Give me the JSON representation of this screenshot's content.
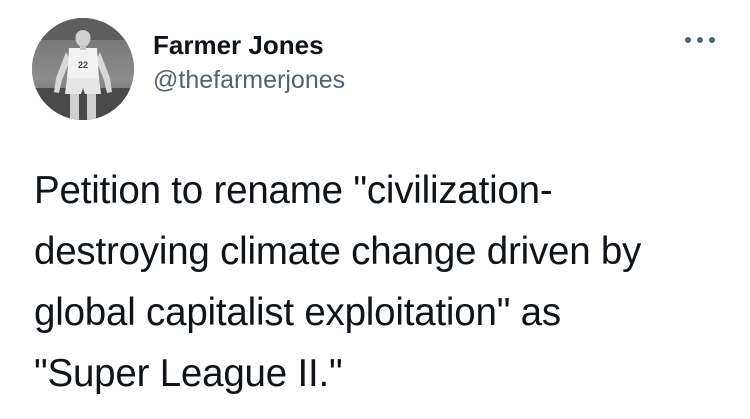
{
  "author": {
    "name": "Farmer Jones",
    "handle": "@thefarmerjones"
  },
  "avatar": {
    "icon": "basketball-player-photo",
    "jersey_text": "22"
  },
  "more_icon": "more-horizontal-icon",
  "tweet": {
    "lines": [
      "Petition to rename \"civilization-",
      "destroying climate change driven by",
      "global capitalist exploitation\" as",
      "\"Super League II.\""
    ]
  },
  "colors": {
    "text": "#0f1419",
    "secondary": "#536471"
  }
}
